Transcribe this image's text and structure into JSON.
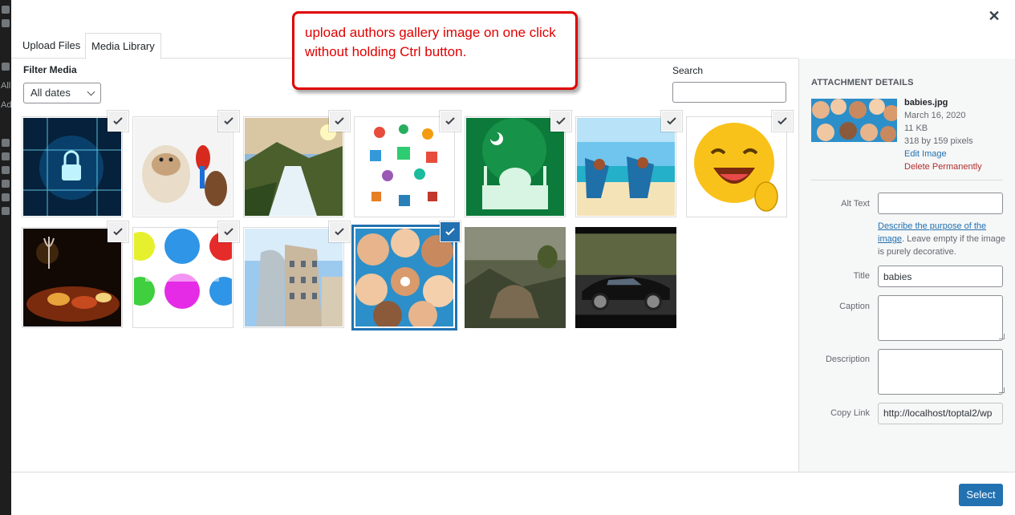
{
  "admin_strip": {
    "items": [
      "All",
      "Ad"
    ]
  },
  "tabs": {
    "upload": "Upload Files",
    "library": "Media Library"
  },
  "filter": {
    "label": "Filter Media",
    "dates_value": "All dates"
  },
  "search": {
    "label": "Search",
    "value": ""
  },
  "callout": {
    "text": "upload authors gallery image on one click without holding Ctrl button."
  },
  "attachments": [
    {
      "name": "cyber-security",
      "checked": true
    },
    {
      "name": "bulldog-parrot-cat",
      "checked": true
    },
    {
      "name": "waterfall-landscape",
      "checked": true
    },
    {
      "name": "icons-tree",
      "checked": true
    },
    {
      "name": "mosque-green",
      "checked": true
    },
    {
      "name": "beach-chairs",
      "checked": true
    },
    {
      "name": "laughing-emoji",
      "checked": true
    },
    {
      "name": "dinner-table",
      "checked": true
    },
    {
      "name": "emoji-faces-canstock",
      "checked": true
    },
    {
      "name": "dancing-house",
      "checked": true
    },
    {
      "name": "babies",
      "checked": true,
      "selected": true
    },
    {
      "name": "fantasy-landscape",
      "checked": false
    },
    {
      "name": "black-sports-car",
      "checked": false
    }
  ],
  "details": {
    "heading": "Attachment Details",
    "filename": "babies.jpg",
    "date": "March 16, 2020",
    "size": "11 KB",
    "dimensions": "318 by 159 pixels",
    "edit_link": "Edit Image",
    "delete_link": "Delete Permanently",
    "alt_label": "Alt Text",
    "alt_value": "",
    "alt_help_link": "Describe the purpose of the image",
    "alt_help_rest": ". Leave empty if the image is purely decorative.",
    "title_label": "Title",
    "title_value": "babies",
    "caption_label": "Caption",
    "caption_value": "",
    "description_label": "Description",
    "description_value": "",
    "copy_label": "Copy Link",
    "copy_value": "http://localhost/toptal2/wp"
  },
  "toolbar": {
    "select_label": "Select"
  },
  "colors": {
    "accent": "#2271b1",
    "callout": "#e00000",
    "delete": "#b32d2e"
  }
}
